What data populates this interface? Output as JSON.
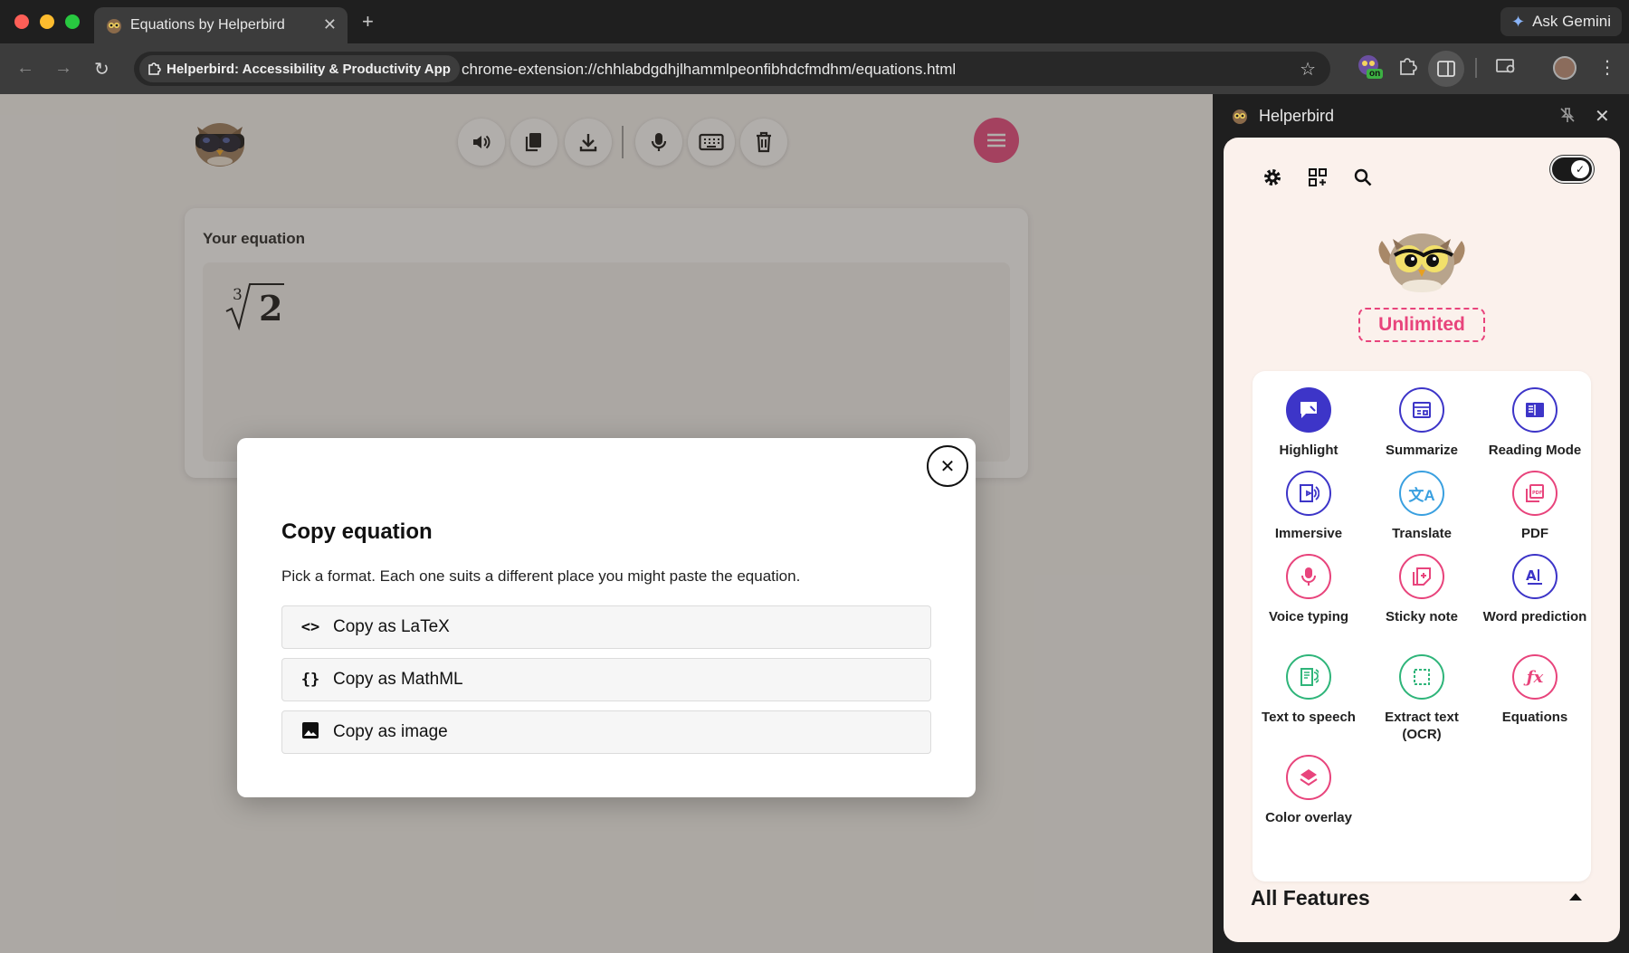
{
  "browser": {
    "tab": {
      "title": "Equations by Helperbird"
    },
    "ask_gemini": "Ask Gemini",
    "site_chip": "Helperbird: Accessibility & Productivity App",
    "url": "chrome-extension://chhlabdgdhjlhammlpeonfibhdcfmdhm/equations.html",
    "ext_badge": "on"
  },
  "page": {
    "equation_label": "Your equation",
    "equation": {
      "index": "3",
      "radicand": "2"
    },
    "toolbar_icons": [
      "speaker-icon",
      "copy-icon",
      "download-icon",
      "microphone-icon",
      "keyboard-icon",
      "trash-icon"
    ]
  },
  "modal": {
    "title": "Copy equation",
    "description": "Pick a format. Each one suits a different place you might paste the equation.",
    "options": [
      {
        "label": "Copy as LaTeX",
        "icon": "code-icon"
      },
      {
        "label": "Copy as MathML",
        "icon": "braces-icon"
      },
      {
        "label": "Copy as image",
        "icon": "image-icon"
      }
    ]
  },
  "sidepanel": {
    "title": "Helperbird",
    "plan": "Unlimited",
    "features": [
      {
        "label": "Highlight",
        "color": "#3d35c8",
        "filled": true
      },
      {
        "label": "Summarize",
        "color": "#3d35c8"
      },
      {
        "label": "Reading Mode",
        "color": "#3d35c8"
      },
      {
        "label": "Immersive",
        "color": "#3d35c8"
      },
      {
        "label": "Translate",
        "color": "#3aa0e0"
      },
      {
        "label": "PDF",
        "color": "#e8447c"
      },
      {
        "label": "Voice typing",
        "color": "#e8447c"
      },
      {
        "label": "Sticky note",
        "color": "#e8447c"
      },
      {
        "label": "Word prediction",
        "color": "#3d35c8"
      },
      {
        "label": "Text to speech",
        "color": "#2fb57a"
      },
      {
        "label": "Extract text (OCR)",
        "color": "#2fb57a"
      },
      {
        "label": "Equations",
        "color": "#e8447c"
      },
      {
        "label": "Color overlay",
        "color": "#e8447c"
      }
    ],
    "all_features": "All Features"
  },
  "colors": {
    "accent": "#e8447c",
    "primary": "#3d35c8"
  }
}
